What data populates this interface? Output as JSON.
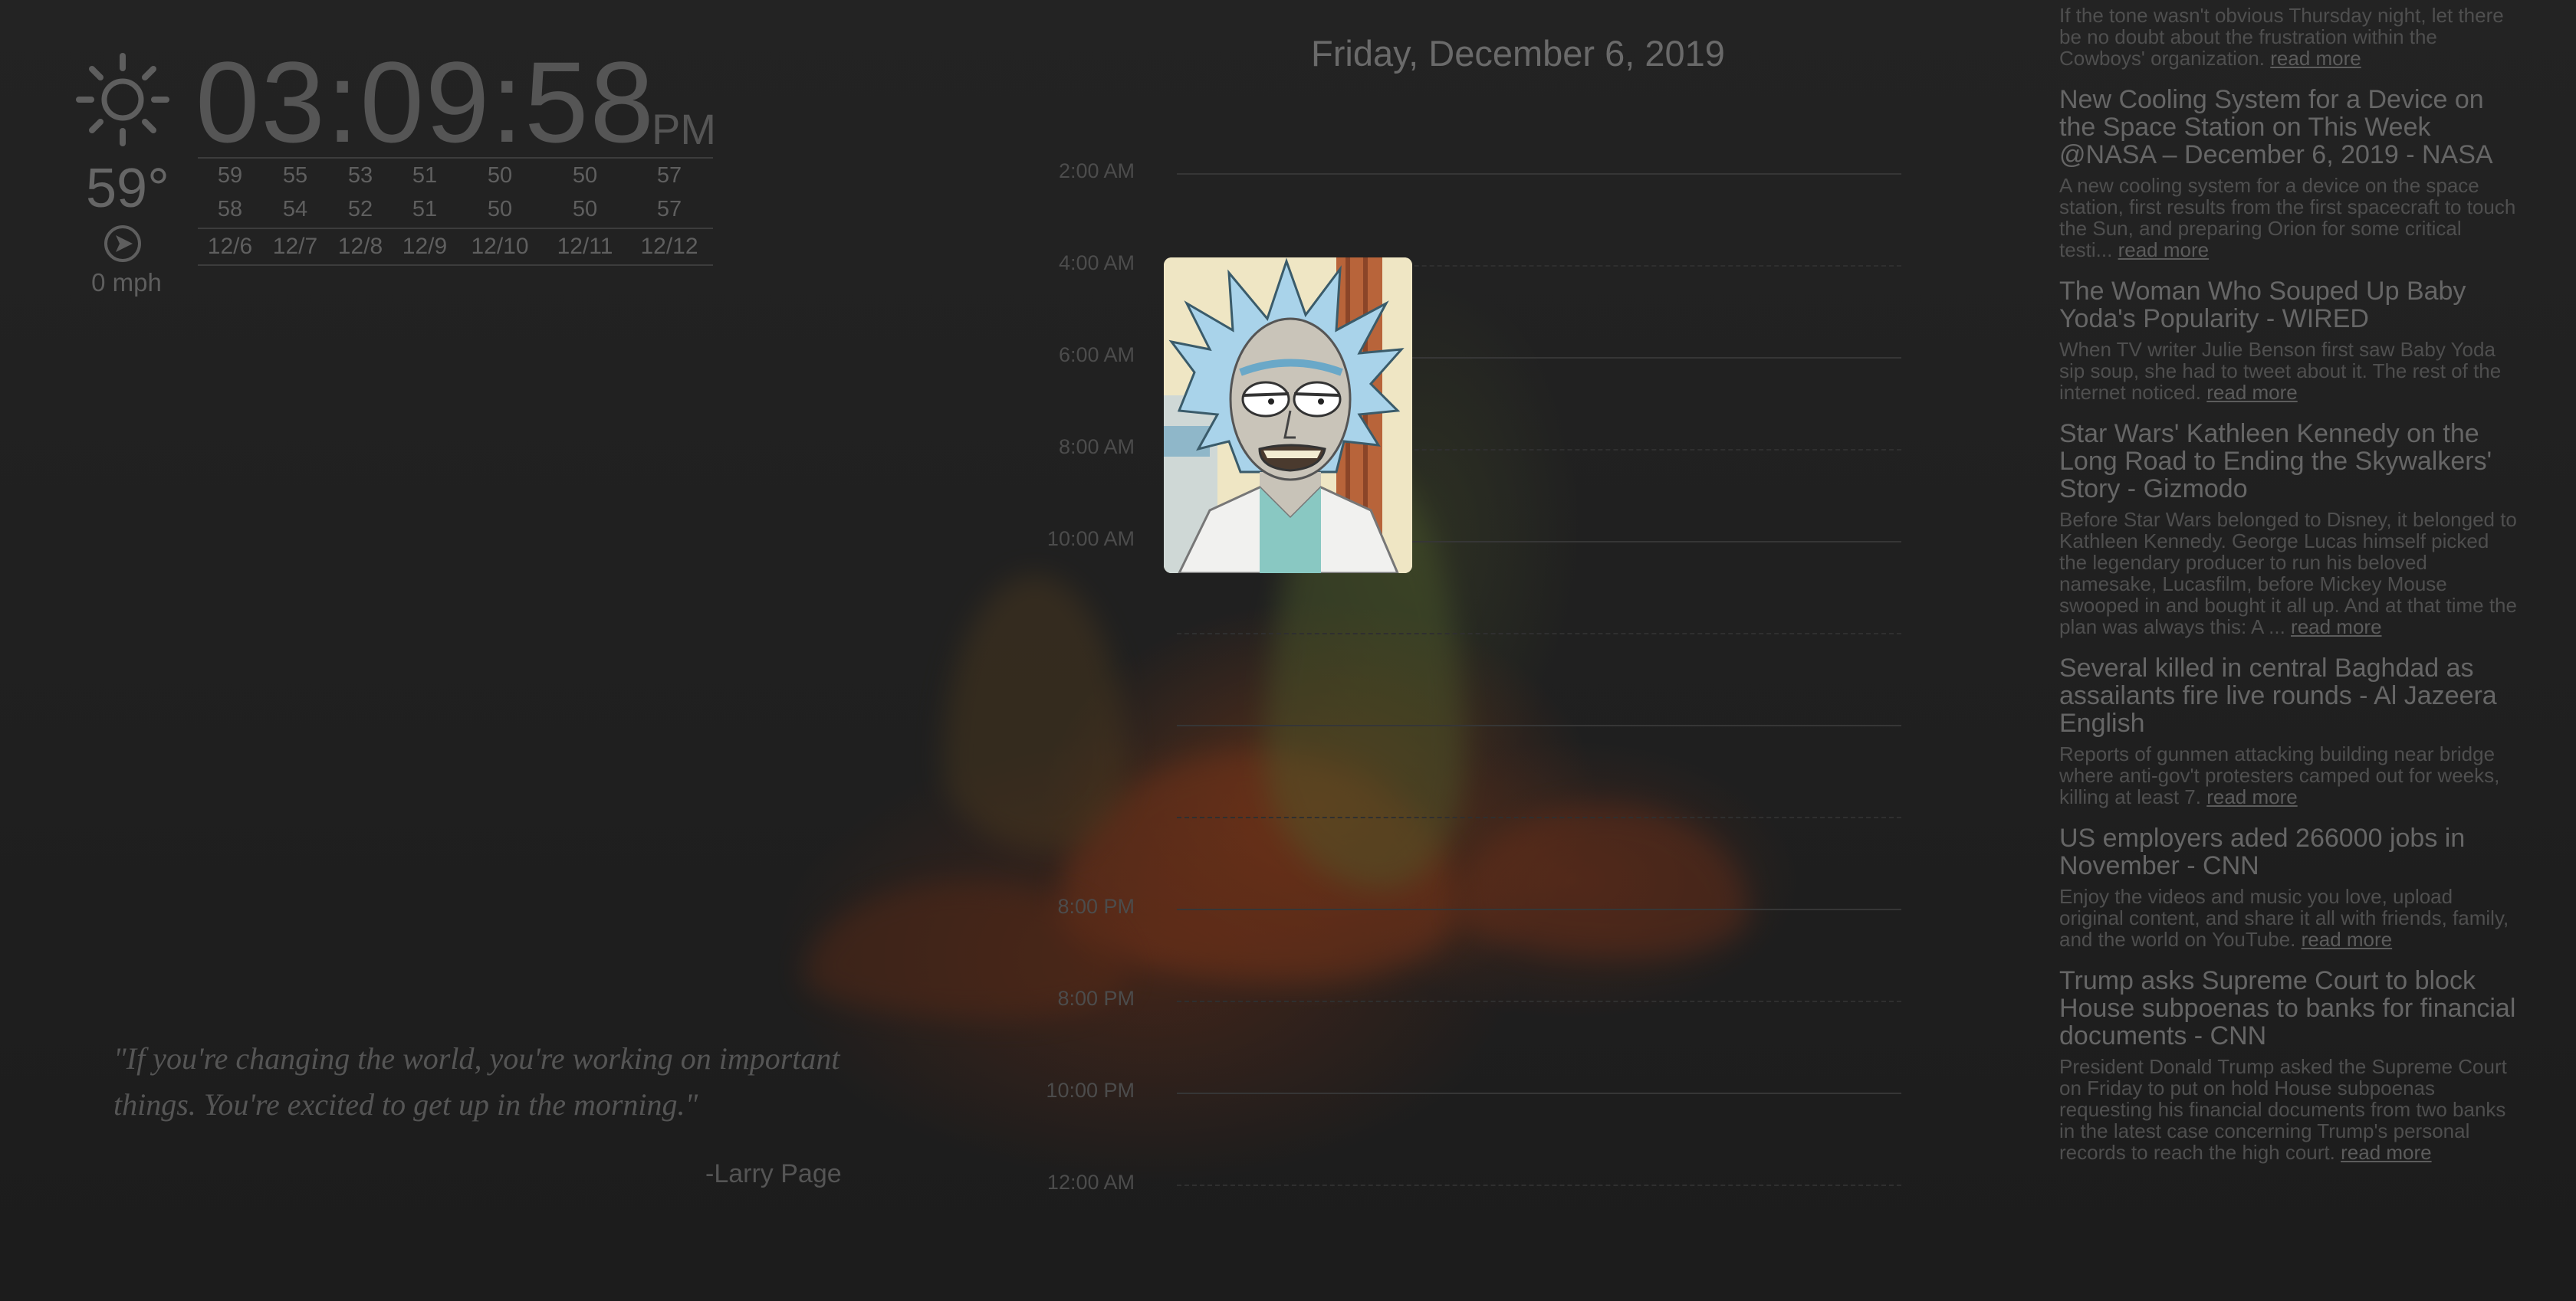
{
  "clock": {
    "time": "03:09:58",
    "ampm": "PM"
  },
  "weather": {
    "icon": "sun-icon",
    "temperature": "59°",
    "wind_icon": "wind-direction-icon",
    "wind_speed": "0 mph",
    "forecast": {
      "highs": [
        "59",
        "55",
        "53",
        "51",
        "50",
        "50",
        "57"
      ],
      "lows": [
        "58",
        "54",
        "52",
        "51",
        "50",
        "50",
        "57"
      ],
      "dates": [
        "12/6",
        "12/7",
        "12/8",
        "12/9",
        "12/10",
        "12/11",
        "12/12"
      ]
    }
  },
  "date_title": "Friday, December 6, 2019",
  "calendar": {
    "hours": [
      "2:00 AM",
      "4:00 AM",
      "6:00 AM",
      "8:00 AM",
      "10:00 AM",
      "",
      "",
      "",
      "8:00 PM",
      "8:00 PM",
      "10:00 PM",
      "12:00 AM"
    ]
  },
  "quote": {
    "text": "\"If you're changing the world, you're working on important things. You're excited to get up in the morning.\"",
    "author": "-Larry Page"
  },
  "news": {
    "items": [
      {
        "title": "",
        "desc": "If the tone wasn't obvious Thursday night, let there be no doubt about the frustration within the Cowboys' organization.",
        "link": "read more"
      },
      {
        "title": "New Cooling System for a Device on the Space Station on This Week @NASA – December 6, 2019 - NASA",
        "desc": "A new cooling system for a device on the space station, first results from the first spacecraft to touch the Sun, and preparing Orion for some critical testi...",
        "link": "read more"
      },
      {
        "title": "The Woman Who Souped Up Baby Yoda's Popularity - WIRED",
        "desc": "When TV writer Julie Benson first saw Baby Yoda sip soup, she had to tweet about it. The rest of the internet noticed.",
        "link": "read more"
      },
      {
        "title": "Star Wars' Kathleen Kennedy on the Long Road to Ending the Skywalkers' Story - Gizmodo",
        "desc": "Before Star Wars belonged to Disney, it belonged to Kathleen Kennedy. George Lucas himself picked the legendary producer to run his beloved namesake, Lucasfilm, before Mickey Mouse swooped in and bought it all up. And at that time the plan was always this: A ...",
        "link": "read more"
      },
      {
        "title": "Several killed in central Baghdad as assailants fire live rounds - Al Jazeera English",
        "desc": "Reports of gunmen attacking building near bridge where anti-gov't protesters camped out for weeks, killing at least 7.",
        "link": "read more"
      },
      {
        "title": "US employers aded 266000 jobs in November - CNN",
        "desc": "Enjoy the videos and music you love, upload original content, and share it all with friends, family, and the world on YouTube.",
        "link": "read more"
      },
      {
        "title": "Trump asks Supreme Court to block House subpoenas to banks for financial documents - CNN",
        "desc": "President Donald Trump asked the Supreme Court on Friday to put on hold House subpoenas requesting his financial documents from two banks in the latest case concerning Trump's personal records to reach the high court.",
        "link": "read more"
      }
    ]
  }
}
